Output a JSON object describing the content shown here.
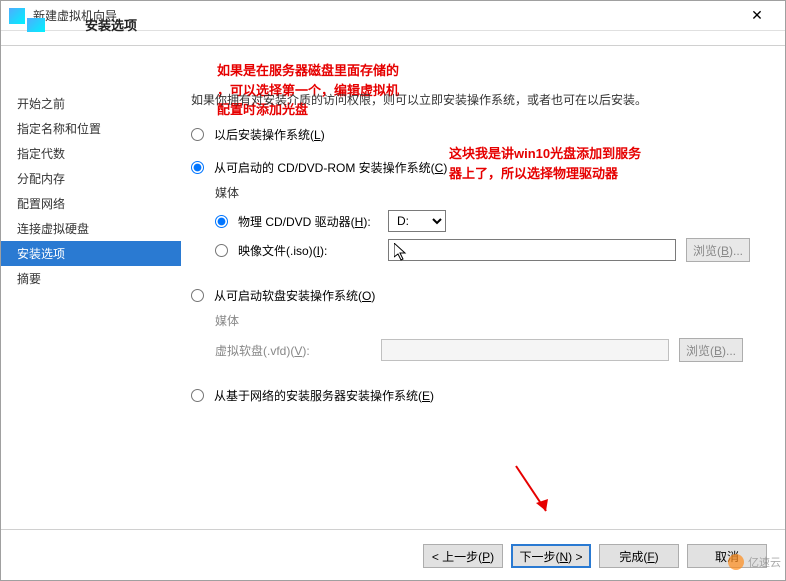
{
  "window": {
    "title": "新建虚拟机向导"
  },
  "page": {
    "title": "安装选项"
  },
  "annotations": {
    "red1": "如果是在服务器磁盘里面存储的\n，可以选择第一个，编辑虚拟机\n配置时添加光盘",
    "red2": "这块我是讲win10光盘添加到服务\n器上了，所以选择物理驱动器"
  },
  "steps": [
    {
      "label": "开始之前"
    },
    {
      "label": "指定名称和位置"
    },
    {
      "label": "指定代数"
    },
    {
      "label": "分配内存"
    },
    {
      "label": "配置网络"
    },
    {
      "label": "连接虚拟硬盘"
    },
    {
      "label": "安装选项",
      "active": true
    },
    {
      "label": "摘要"
    }
  ],
  "instruction": "如果你拥有对安装介质的访问权限，则可以立即安装操作系统，或者也可在以后安装。",
  "options": {
    "later": {
      "label": "以后安装操作系统(L)",
      "selected": false
    },
    "cddvd": {
      "label": "从可启动的 CD/DVD-ROM 安装操作系统(C)",
      "selected": true,
      "media_heading": "媒体",
      "physical": {
        "label": "物理 CD/DVD 驱动器(H):",
        "selected": true,
        "value": "D:"
      },
      "iso": {
        "label": "映像文件(.iso)(I):",
        "selected": false,
        "value": "",
        "browse": "浏览(B)..."
      }
    },
    "floppy": {
      "label": "从可启动软盘安装操作系统(O)",
      "selected": false,
      "media_heading": "媒体",
      "vfd": {
        "label": "虚拟软盘(.vfd)(V):",
        "value": "",
        "browse": "浏览(B)..."
      }
    },
    "network": {
      "label": "从基于网络的安装服务器安装操作系统(E)",
      "selected": false
    }
  },
  "footer": {
    "prev": "< 上一步(P)",
    "next": "下一步(N) >",
    "finish": "完成(F)",
    "cancel": "取消"
  },
  "watermark": "亿速云"
}
